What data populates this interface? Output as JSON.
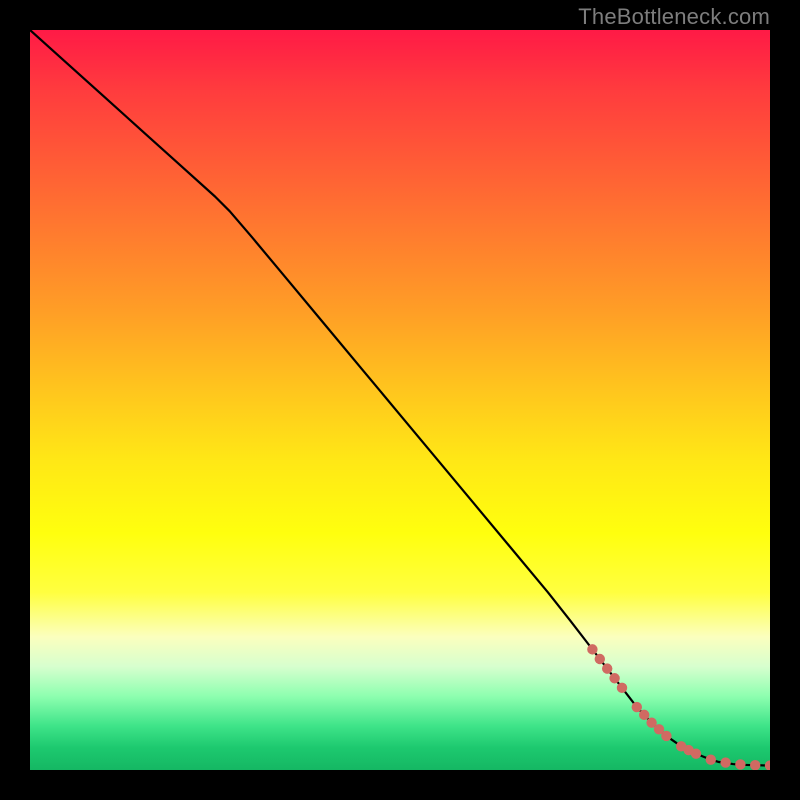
{
  "watermark": "TheBottleneck.com",
  "colors": {
    "page_bg": "#000000",
    "line": "#000000",
    "marker": "#d06a62",
    "gradient_top": "#ff1a46",
    "gradient_mid": "#ffff0e",
    "gradient_bottom": "#15b763"
  },
  "chart_data": {
    "type": "line",
    "title": "",
    "xlabel": "",
    "ylabel": "",
    "xlim": [
      0,
      100
    ],
    "ylim": [
      0,
      100
    ],
    "series": [
      {
        "name": "curve",
        "x": [
          0,
          5,
          10,
          15,
          20,
          25,
          27,
          30,
          35,
          40,
          45,
          50,
          55,
          60,
          65,
          70,
          73,
          75,
          77,
          79,
          81,
          82,
          84,
          86,
          88,
          90,
          92,
          93,
          95,
          96,
          98,
          100
        ],
        "y": [
          100,
          95.5,
          91,
          86.5,
          82,
          77.5,
          75.5,
          72,
          66,
          60,
          54,
          48,
          42,
          36,
          30,
          24,
          20.2,
          17.6,
          15.0,
          12.4,
          9.8,
          8.5,
          6.4,
          4.6,
          3.2,
          2.2,
          1.4,
          1.1,
          0.8,
          0.7,
          0.65,
          0.6
        ]
      },
      {
        "name": "markers",
        "x": [
          76,
          77,
          78,
          79,
          80,
          82,
          83,
          84,
          85,
          86,
          88,
          89,
          90,
          92,
          94,
          96,
          98,
          100
        ],
        "y": [
          16.3,
          15.0,
          13.7,
          12.4,
          11.1,
          8.5,
          7.45,
          6.4,
          5.5,
          4.6,
          3.2,
          2.7,
          2.2,
          1.4,
          1.0,
          0.75,
          0.65,
          0.6
        ]
      }
    ]
  }
}
